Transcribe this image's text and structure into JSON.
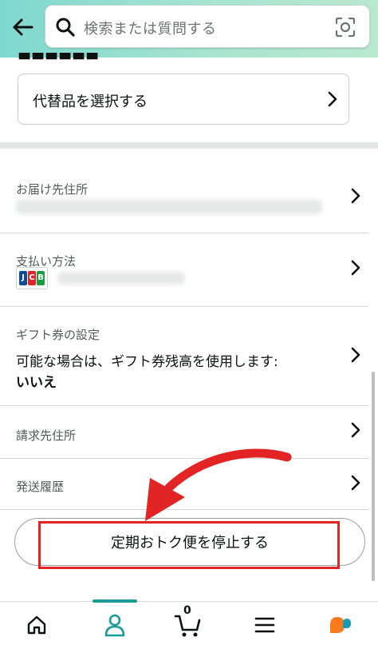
{
  "header": {
    "search_placeholder": "検索または質問する"
  },
  "substitute": {
    "label": "代替品を選択する"
  },
  "rows": {
    "address_title": "お届け先住所",
    "payment_title": "支払い方法",
    "payment_card": "JCB",
    "gift_title": "ギフト券の設定",
    "gift_text": "可能な場合は、ギフト券残高を使用します:",
    "gift_value": "いいえ",
    "billing_title": "請求先住所",
    "history_title": "発送履歴"
  },
  "stop_button": {
    "label": "定期おトク便を停止する"
  },
  "nav": {
    "cart_count": "0",
    "active_tab": "account"
  },
  "colors": {
    "header_gradient_start": "#7fd8cf",
    "header_gradient_end": "#b9e9cf",
    "annotation_red": "#e32424",
    "nav_accent": "#1a9b95"
  }
}
